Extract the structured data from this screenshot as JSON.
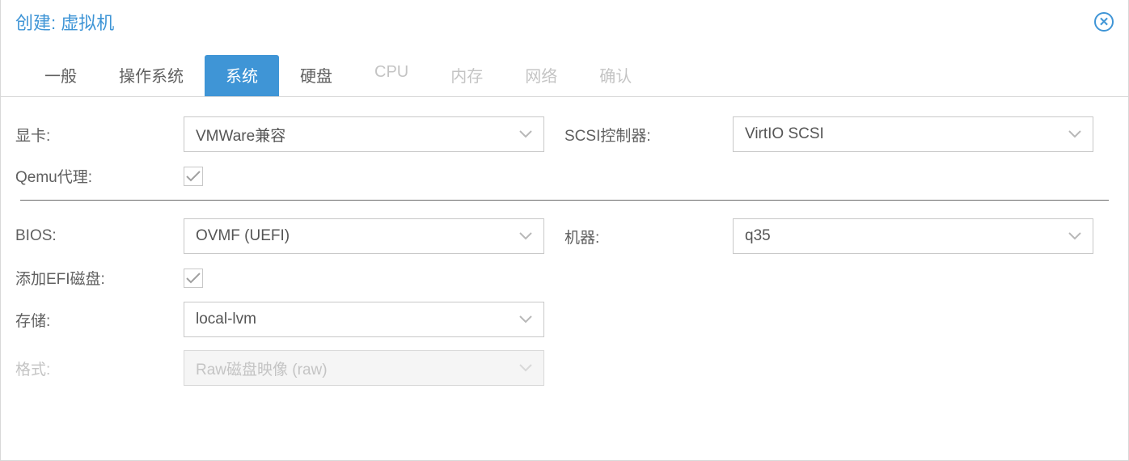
{
  "title": "创建: 虚拟机",
  "tabs": {
    "general": "一般",
    "os": "操作系统",
    "system": "系统",
    "disk": "硬盘",
    "cpu": "CPU",
    "memory": "内存",
    "network": "网络",
    "confirm": "确认"
  },
  "labels": {
    "display": "显卡:",
    "scsi": "SCSI控制器:",
    "qemu_agent": "Qemu代理:",
    "bios": "BIOS:",
    "machine": "机器:",
    "add_efi": "添加EFI磁盘:",
    "storage": "存储:",
    "format": "格式:"
  },
  "values": {
    "display": "VMWare兼容",
    "scsi": "VirtIO SCSI",
    "bios": "OVMF (UEFI)",
    "machine": "q35",
    "storage": "local-lvm",
    "format": "Raw磁盘映像 (raw)",
    "qemu_agent_checked": true,
    "add_efi_checked": true
  }
}
